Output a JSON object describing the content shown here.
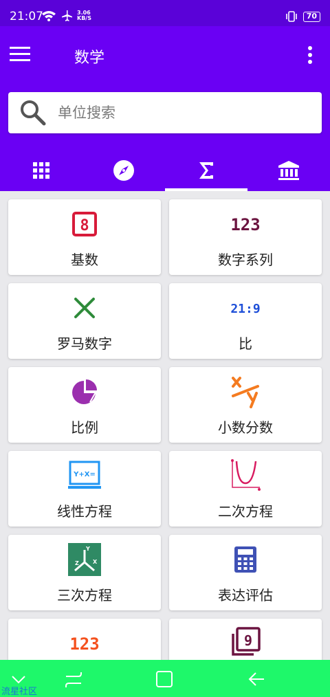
{
  "status": {
    "time": "21:07",
    "net_speed_value": "3.06",
    "net_speed_unit": "KB/S",
    "battery": "70"
  },
  "app": {
    "title": "数学",
    "accent": "#6a00f4"
  },
  "search": {
    "placeholder": "单位搜索",
    "value": ""
  },
  "tabs": [
    {
      "icon": "grid-icon",
      "active": false
    },
    {
      "icon": "compass-icon",
      "active": false
    },
    {
      "icon": "sigma-icon",
      "active": true
    },
    {
      "icon": "bank-icon",
      "active": false
    }
  ],
  "cards": [
    {
      "label": "基数",
      "icon": "digit-eight-icon",
      "glyph": "8"
    },
    {
      "label": "数字系列",
      "icon": "number-series-icon",
      "glyph": "123"
    },
    {
      "label": "罗马数字",
      "icon": "roman-x-icon",
      "glyph": ""
    },
    {
      "label": "比",
      "icon": "ratio-icon",
      "glyph": "21:9"
    },
    {
      "label": "比例",
      "icon": "pie-chart-icon",
      "glyph": ""
    },
    {
      "label": "小数分数",
      "icon": "fraction-icon",
      "glyph": ""
    },
    {
      "label": "线性方程",
      "icon": "linear-equation-icon",
      "glyph": "Y+X="
    },
    {
      "label": "二次方程",
      "icon": "parabola-icon",
      "glyph": ""
    },
    {
      "label": "三次方程",
      "icon": "cubic-equation-icon",
      "glyph": ""
    },
    {
      "label": "表达评估",
      "icon": "calculator-icon",
      "glyph": ""
    },
    {
      "label": "",
      "icon": "number-123-icon",
      "glyph": "123"
    },
    {
      "label": "",
      "icon": "layered-nine-icon",
      "glyph": "9"
    }
  ],
  "nav": {
    "watermark": "流星社区"
  }
}
